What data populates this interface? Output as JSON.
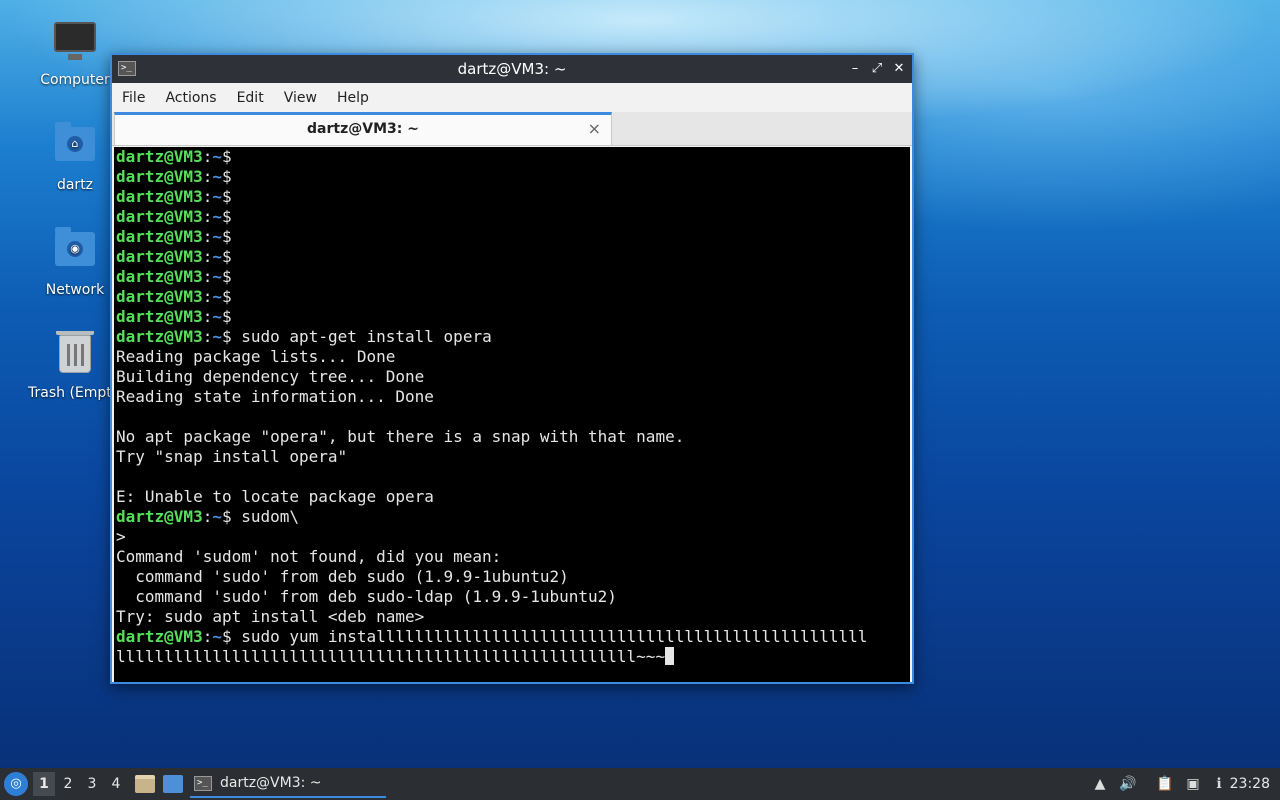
{
  "desktop": {
    "icons": [
      {
        "label": "Computer",
        "icon": "computer-icon"
      },
      {
        "label": "dartz",
        "icon": "home-folder-icon"
      },
      {
        "label": "Network",
        "icon": "network-folder-icon"
      },
      {
        "label": "Trash (Empty)",
        "icon": "trash-icon"
      }
    ]
  },
  "window": {
    "title": "dartz@VM3: ~",
    "app_icon_glyph": ">_",
    "controls": {
      "minimize": "–",
      "maximize": "⤢",
      "close": "✕"
    },
    "menus": [
      "File",
      "Actions",
      "Edit",
      "View",
      "Help"
    ],
    "tab": {
      "label": "dartz@VM3: ~",
      "close": "×"
    }
  },
  "terminal": {
    "prompt_user": "dartz@VM3",
    "prompt_sep": ":",
    "prompt_path": "~",
    "prompt_symbol": "$",
    "lines": [
      {
        "type": "prompt",
        "cmd": ""
      },
      {
        "type": "prompt",
        "cmd": ""
      },
      {
        "type": "prompt",
        "cmd": ""
      },
      {
        "type": "prompt",
        "cmd": ""
      },
      {
        "type": "prompt",
        "cmd": ""
      },
      {
        "type": "prompt",
        "cmd": ""
      },
      {
        "type": "prompt",
        "cmd": ""
      },
      {
        "type": "prompt",
        "cmd": ""
      },
      {
        "type": "prompt",
        "cmd": ""
      },
      {
        "type": "prompt",
        "cmd": " sudo apt-get install opera"
      },
      {
        "type": "out",
        "text": "Reading package lists... Done"
      },
      {
        "type": "out",
        "text": "Building dependency tree... Done"
      },
      {
        "type": "out",
        "text": "Reading state information... Done"
      },
      {
        "type": "out",
        "text": ""
      },
      {
        "type": "out",
        "text": "No apt package \"opera\", but there is a snap with that name."
      },
      {
        "type": "out",
        "text": "Try \"snap install opera\""
      },
      {
        "type": "out",
        "text": ""
      },
      {
        "type": "out",
        "text": "E: Unable to locate package opera"
      },
      {
        "type": "prompt",
        "cmd": " sudom\\"
      },
      {
        "type": "out",
        "text": ">"
      },
      {
        "type": "out",
        "text": "Command 'sudom' not found, did you mean:"
      },
      {
        "type": "out",
        "text": "  command 'sudo' from deb sudo (1.9.9-1ubuntu2)"
      },
      {
        "type": "out",
        "text": "  command 'sudo' from deb sudo-ldap (1.9.9-1ubuntu2)"
      },
      {
        "type": "out",
        "text": "Try: sudo apt install <deb name>"
      },
      {
        "type": "prompt",
        "cmd": " sudo yum installlllllllllllllllllllllllllllllllllllllllllllllllll"
      },
      {
        "type": "cursorline",
        "text": "llllllllllllllllllllllllllllllllllllllllllllllllllllll~~~"
      }
    ]
  },
  "taskbar": {
    "start_icon": "lubuntu-menu-icon",
    "workspaces": [
      "1",
      "2",
      "3",
      "4"
    ],
    "active_workspace": "1",
    "task_label": "dartz@VM3: ~",
    "clock": "23:28"
  }
}
